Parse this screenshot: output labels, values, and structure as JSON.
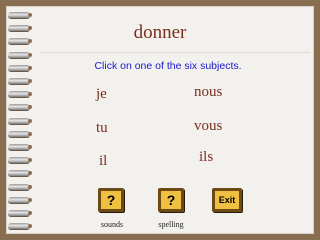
{
  "title": "donner",
  "instruction": "Click on one of the six subjects.",
  "subjects": {
    "je": "je",
    "tu": "tu",
    "il": "il",
    "nous": "nous",
    "vous": "vous",
    "ils": "ils"
  },
  "buttons": {
    "sounds_symbol": "?",
    "spelling_symbol": "?",
    "exit_label": "Exit"
  },
  "captions": {
    "sounds": "sounds",
    "spelling": "spelling"
  },
  "colors": {
    "background": "#8a6e52",
    "paper": "#f3f1ee",
    "title_text": "#7a2f1e",
    "instruction_text": "#1a1acc",
    "button_fill": "#f0c040",
    "button_border": "#6b4a14"
  }
}
